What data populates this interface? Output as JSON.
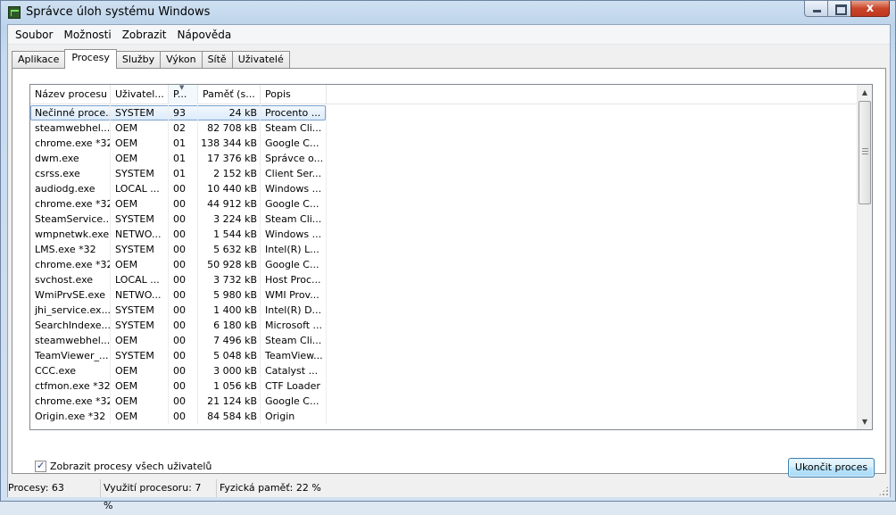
{
  "window": {
    "title": "Správce úloh systému Windows",
    "close_glyph": "x"
  },
  "menu": [
    "Soubor",
    "Možnosti",
    "Zobrazit",
    "Nápověda"
  ],
  "tabs": [
    {
      "label": "Aplikace",
      "active": false
    },
    {
      "label": "Procesy",
      "active": true
    },
    {
      "label": "Služby",
      "active": false
    },
    {
      "label": "Výkon",
      "active": false
    },
    {
      "label": "Sítě",
      "active": false
    },
    {
      "label": "Uživatelé",
      "active": false
    }
  ],
  "table": {
    "columns": [
      "Název procesu",
      "Uživatel...",
      "P...",
      "Paměť (s...",
      "Popis"
    ],
    "sorted_column": 2,
    "rows": [
      [
        "Nečinné proce...",
        "SYSTEM",
        "93",
        "24 kB",
        "Procento ..."
      ],
      [
        "steamwebhel...",
        "OEM",
        "02",
        "82 708 kB",
        "Steam Cli..."
      ],
      [
        "chrome.exe *32",
        "OEM",
        "01",
        "138 344 kB",
        "Google C..."
      ],
      [
        "dwm.exe",
        "OEM",
        "01",
        "17 376 kB",
        "Správce o..."
      ],
      [
        "csrss.exe",
        "SYSTEM",
        "01",
        "2 152 kB",
        "Client Ser..."
      ],
      [
        "audiodg.exe",
        "LOCAL ...",
        "00",
        "10 440 kB",
        "Windows ..."
      ],
      [
        "chrome.exe *32",
        "OEM",
        "00",
        "44 912 kB",
        "Google C..."
      ],
      [
        "SteamService...",
        "SYSTEM",
        "00",
        "3 224 kB",
        "Steam Cli..."
      ],
      [
        "wmpnetwk.exe",
        "NETWO...",
        "00",
        "1 544 kB",
        "Windows ..."
      ],
      [
        "LMS.exe *32",
        "SYSTEM",
        "00",
        "5 632 kB",
        "Intel(R) L..."
      ],
      [
        "chrome.exe *32",
        "OEM",
        "00",
        "50 928 kB",
        "Google C..."
      ],
      [
        "svchost.exe",
        "LOCAL ...",
        "00",
        "3 732 kB",
        "Host Proc..."
      ],
      [
        "WmiPrvSE.exe",
        "NETWO...",
        "00",
        "5 980 kB",
        "WMI Prov..."
      ],
      [
        "jhi_service.ex...",
        "SYSTEM",
        "00",
        "1 400 kB",
        "Intel(R) D..."
      ],
      [
        "SearchIndexe...",
        "SYSTEM",
        "00",
        "6 180 kB",
        "Microsoft ..."
      ],
      [
        "steamwebhel...",
        "OEM",
        "00",
        "7 496 kB",
        "Steam Cli..."
      ],
      [
        "TeamViewer_...",
        "SYSTEM",
        "00",
        "5 048 kB",
        "TeamView..."
      ],
      [
        "CCC.exe",
        "OEM",
        "00",
        "3 000 kB",
        "Catalyst ..."
      ],
      [
        "ctfmon.exe *32",
        "OEM",
        "00",
        "1 056 kB",
        "CTF Loader"
      ],
      [
        "chrome.exe *32",
        "OEM",
        "00",
        "21 124 kB",
        "Google C..."
      ],
      [
        "Origin.exe *32",
        "OEM",
        "00",
        "84 584 kB",
        "Origin"
      ]
    ]
  },
  "show_all_users": {
    "label": "Zobrazit procesy všech uživatelů",
    "checked": true
  },
  "end_process_label": "Ukončit proces",
  "status": {
    "processes": "Procesy: 63",
    "cpu": "Využití procesoru: 7 %",
    "memory": "Fyzická paměť: 22 %"
  }
}
